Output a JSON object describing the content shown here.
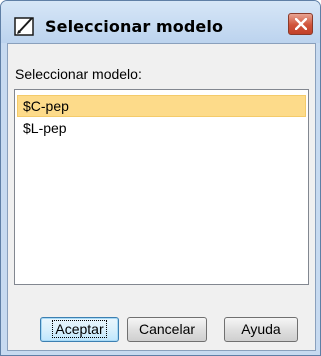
{
  "window": {
    "title": "Seleccionar modelo",
    "icon": "pencil-edit-icon",
    "close_icon": "close-icon"
  },
  "prompt_label": "Seleccionar modelo:",
  "models": [
    {
      "label": "$C-pep",
      "selected": true
    },
    {
      "label": "$L-pep",
      "selected": false
    }
  ],
  "buttons": {
    "accept": "Aceptar",
    "cancel": "Cancelar",
    "help": "Ayuda"
  },
  "colors": {
    "selection": "#fddb8a",
    "titlebar": "#c7daf0",
    "close_button": "#d0533a"
  }
}
